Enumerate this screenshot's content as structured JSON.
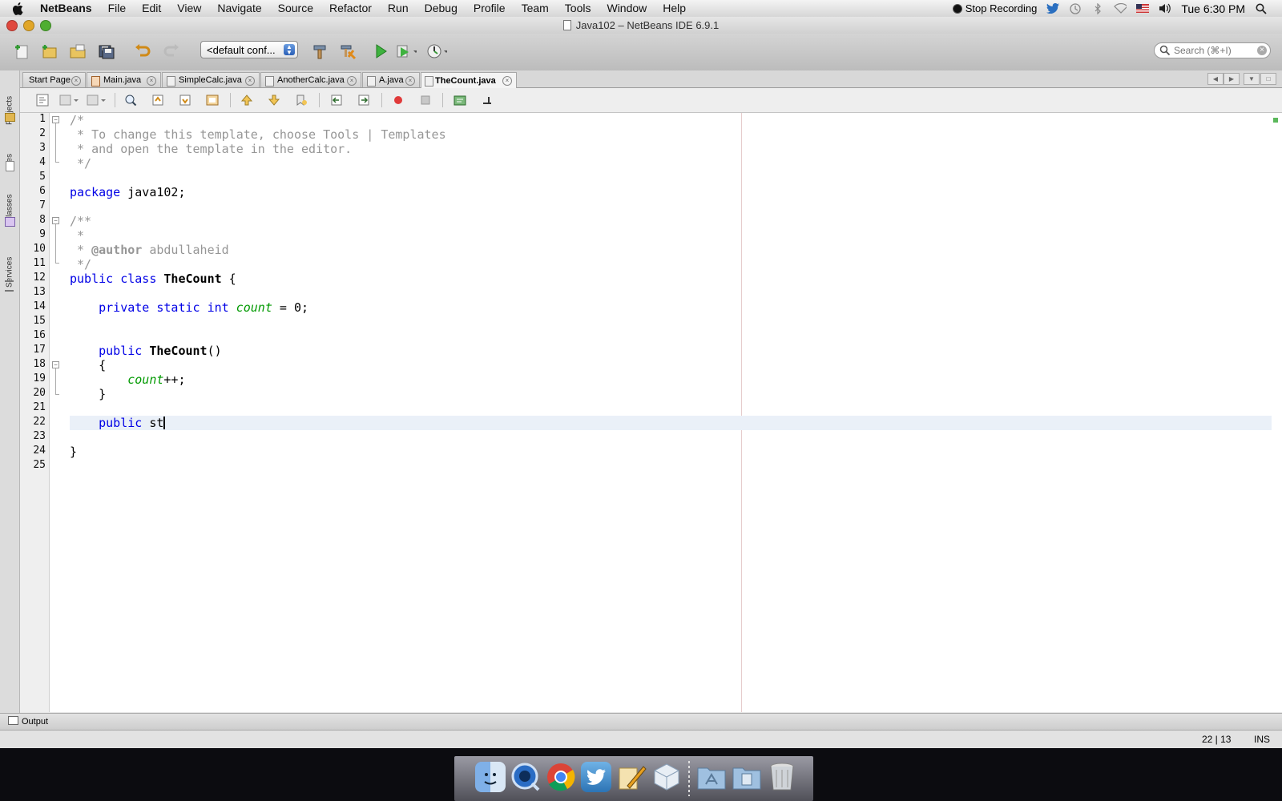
{
  "menubar": {
    "app": "NetBeans",
    "items": [
      "File",
      "Edit",
      "View",
      "Navigate",
      "Source",
      "Refactor",
      "Run",
      "Debug",
      "Profile",
      "Team",
      "Tools",
      "Window",
      "Help"
    ],
    "recording": "Stop Recording",
    "clock": "Tue 6:30 PM"
  },
  "window": {
    "title": "Java102 – NetBeans IDE 6.9.1"
  },
  "toolbar": {
    "config_value": "<default conf...",
    "search_placeholder": "Search (⌘+I)"
  },
  "sidebar": {
    "tabs": [
      "Projects",
      "Files",
      "Classes",
      "Services"
    ]
  },
  "tabs": [
    {
      "label": "Start Page",
      "active": false
    },
    {
      "label": "Main.java",
      "active": false
    },
    {
      "label": "SimpleCalc.java",
      "active": false
    },
    {
      "label": "AnotherCalc.java",
      "active": false
    },
    {
      "label": "A.java",
      "active": false
    },
    {
      "label": "TheCount.java",
      "active": true
    }
  ],
  "editor": {
    "line_numbers": [
      "1",
      "2",
      "3",
      "4",
      "5",
      "6",
      "7",
      "8",
      "9",
      "10",
      "11",
      "12",
      "13",
      "14",
      "15",
      "16",
      "17",
      "18",
      "19",
      "20",
      "21",
      "22",
      "23",
      "24",
      "25"
    ],
    "code": {
      "l1": "/*",
      "l2": " * To change this template, choose Tools | Templates",
      "l3": " * and open the template in the editor.",
      "l4": " */",
      "l6_kw": "package",
      "l6_rest": " java102;",
      "l8": "/**",
      "l9": " *",
      "l10_a": " * ",
      "l10_tag": "@author",
      "l10_b": " abdullaheid",
      "l11": " */",
      "l12_kw": "public class ",
      "l12_name": "TheCount",
      "l12_rest": " {",
      "l14_kw": "    private static int ",
      "l14_field": "count",
      "l14_rest": " = 0;",
      "l17_kw": "    public ",
      "l17_name": "TheCount",
      "l17_rest": "()",
      "l18": "    {",
      "l19_indent": "        ",
      "l19_field": "count",
      "l19_rest": "++;",
      "l20": "    }",
      "l22_kw": "    public ",
      "l22_rest": "st",
      "l24": "}"
    },
    "cursor_line": 22
  },
  "output": {
    "label": "Output"
  },
  "status": {
    "position": "22 | 13",
    "mode": "INS"
  },
  "colors": {
    "keyword": "#0000e6",
    "comment": "#969696",
    "field": "#009900"
  },
  "dock": {
    "icons": [
      "finder-icon",
      "quicktime-icon",
      "chrome-icon",
      "twitter-icon",
      "pencil-app-icon",
      "box-app-icon",
      "applications-folder-icon",
      "documents-folder-icon",
      "trash-icon"
    ]
  }
}
